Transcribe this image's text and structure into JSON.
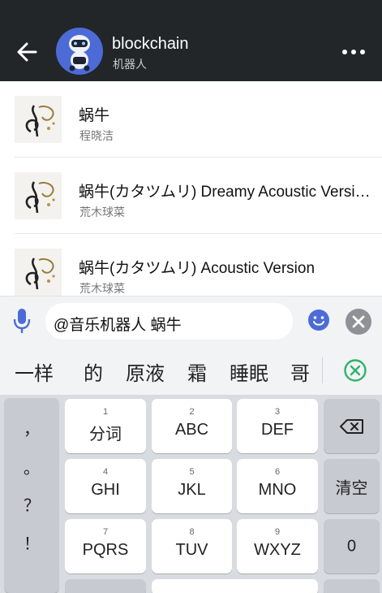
{
  "header": {
    "title": "blockchain",
    "subtitle": "机器人",
    "background": "#222629"
  },
  "songs": [
    {
      "name": "蜗牛",
      "artist": "程晓洁"
    },
    {
      "name": "蜗牛(カタツムリ) Dreamy Acoustic Version",
      "artist": "荒木球菜"
    },
    {
      "name": "蜗牛(カタツムリ) Acoustic Version",
      "artist": "荒木球菜"
    }
  ],
  "input": {
    "value": "@音乐机器人 蜗牛"
  },
  "candidates": [
    "一样",
    "的",
    "原液",
    "霜",
    "睡眠",
    "哥"
  ],
  "keyboard": {
    "symbols": [
      "，",
      "。",
      "？",
      "！"
    ],
    "keys": [
      {
        "num": "1",
        "label": "分词"
      },
      {
        "num": "2",
        "label": "ABC"
      },
      {
        "num": "3",
        "label": "DEF"
      },
      {
        "num": "4",
        "label": "GHI"
      },
      {
        "num": "5",
        "label": "JKL"
      },
      {
        "num": "6",
        "label": "MNO"
      },
      {
        "num": "7",
        "label": "PQRS"
      },
      {
        "num": "8",
        "label": "TUV"
      },
      {
        "num": "9",
        "label": "WXYZ"
      }
    ],
    "clear_label": "清空",
    "zero_label": "0"
  },
  "colors": {
    "accent": "#4c6bd6",
    "candidate_close": "#2fb36b"
  }
}
